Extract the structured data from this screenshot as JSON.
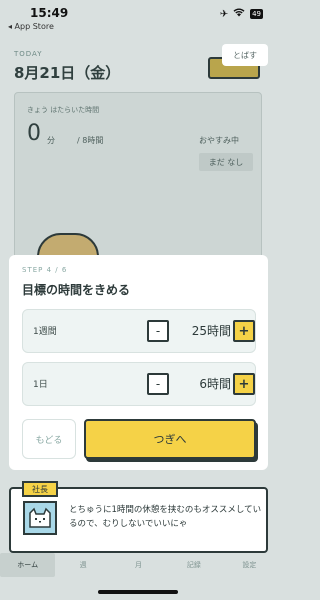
{
  "status_bar": {
    "time": "15:49",
    "back_to_app": "◂ App Store",
    "battery": "49"
  },
  "background": {
    "today_label": "TODAY",
    "date": "8月21日（金）",
    "card_label": "きょう はたらいた時間",
    "worked_value": "0",
    "worked_unit": "分",
    "goal": "/ 8時間",
    "rest_label": "おやすみ中",
    "rest_value": "まだ なし",
    "tab_items": [
      "ホーム",
      "週",
      "月",
      "記録",
      "設定"
    ]
  },
  "skip_button": "とばす",
  "modal": {
    "step": "STEP 4 / 6",
    "title": "目標の時間をきめる",
    "rows": [
      {
        "label": "1週間",
        "value": "25時間",
        "minus": "-",
        "plus": "+"
      },
      {
        "label": "1日",
        "value": "6時間",
        "minus": "-",
        "plus": "+"
      }
    ],
    "back_label": "もどる",
    "next_label": "つぎへ"
  },
  "tooltip": {
    "tag": "社長",
    "text": "とちゅうに1時間の休憩を挟むのもオススメしているので、むりしないでいいにゃ"
  },
  "colors": {
    "accent_yellow": "#f5d247",
    "outline": "#2d3a3a",
    "dim_background": "#d9e0df"
  },
  "icons": [
    "airplane-icon",
    "wifi-icon",
    "battery-icon",
    "cat-avatar-icon"
  ]
}
